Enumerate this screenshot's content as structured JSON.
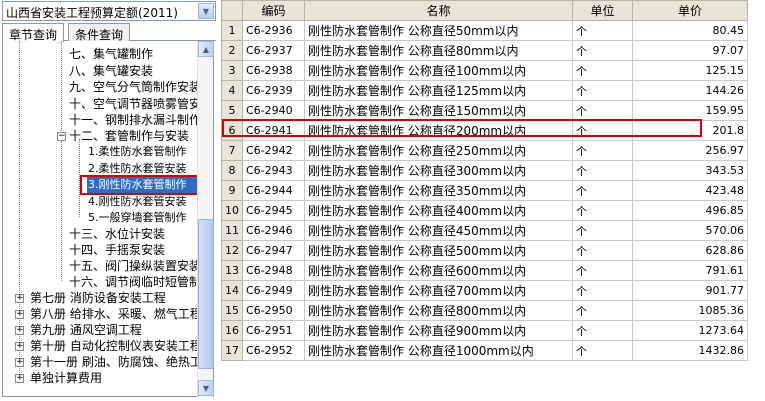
{
  "quota_select": {
    "value": "山西省安装工程预算定额(2011)"
  },
  "tabs": [
    {
      "label": "章节查询"
    },
    {
      "label": "条件查询"
    }
  ],
  "tree": [
    {
      "label": "七、集气罐制作"
    },
    {
      "label": "八、集气罐安装"
    },
    {
      "label": "九、空气分气筒制作安装"
    },
    {
      "label": "十、空气调节器喷雾管安装"
    },
    {
      "label": "十一、钢制排水漏斗制作"
    },
    {
      "label": "十二、套管制作与安装"
    },
    {
      "label": "1.柔性防水套管制作"
    },
    {
      "label": "2.柔性防水套管安装"
    },
    {
      "label": "3.刚性防水套管制作"
    },
    {
      "label": "4.刚性防水套管安装"
    },
    {
      "label": "5.一般穿墙套管制作"
    },
    {
      "label": "十三、水位计安装"
    },
    {
      "label": "十四、手摇泵安装"
    },
    {
      "label": "十五、阀门操纵装置安装"
    },
    {
      "label": "十六、调节阀临时短管制"
    },
    {
      "label": "第七册 消防设备安装工程"
    },
    {
      "label": "第八册 给排水、采暖、燃气工程"
    },
    {
      "label": "第九册 通风空调工程"
    },
    {
      "label": "第十册 自动化控制仪表安装工程"
    },
    {
      "label": "第十一册 刷油、防腐蚀、绝热工程"
    },
    {
      "label": "单独计算费用"
    }
  ],
  "grid": {
    "headers": [
      "",
      "编码",
      "名称",
      "单位",
      "单价"
    ],
    "rows": [
      {
        "n": "1",
        "code": "C6-2936",
        "name": "刚性防水套管制作 公称直径50mm以内",
        "unit": "个",
        "price": "80.45"
      },
      {
        "n": "2",
        "code": "C6-2937",
        "name": "刚性防水套管制作 公称直径80mm以内",
        "unit": "个",
        "price": "97.07"
      },
      {
        "n": "3",
        "code": "C6-2938",
        "name": "刚性防水套管制作 公称直径100mm以内",
        "unit": "个",
        "price": "125.15"
      },
      {
        "n": "4",
        "code": "C6-2939",
        "name": "刚性防水套管制作 公称直径125mm以内",
        "unit": "个",
        "price": "144.26"
      },
      {
        "n": "5",
        "code": "C6-2940",
        "name": "刚性防水套管制作 公称直径150mm以内",
        "unit": "个",
        "price": "159.95"
      },
      {
        "n": "6",
        "code": "C6-2941",
        "name": "刚性防水套管制作 公称直径200mm以内",
        "unit": "个",
        "price": "201.8"
      },
      {
        "n": "7",
        "code": "C6-2942",
        "name": "刚性防水套管制作 公称直径250mm以内",
        "unit": "个",
        "price": "256.97"
      },
      {
        "n": "8",
        "code": "C6-2943",
        "name": "刚性防水套管制作 公称直径300mm以内",
        "unit": "个",
        "price": "343.53"
      },
      {
        "n": "9",
        "code": "C6-2944",
        "name": "刚性防水套管制作 公称直径350mm以内",
        "unit": "个",
        "price": "423.48"
      },
      {
        "n": "10",
        "code": "C6-2945",
        "name": "刚性防水套管制作 公称直径400mm以内",
        "unit": "个",
        "price": "496.85"
      },
      {
        "n": "11",
        "code": "C6-2946",
        "name": "刚性防水套管制作 公称直径450mm以内",
        "unit": "个",
        "price": "570.06"
      },
      {
        "n": "12",
        "code": "C6-2947",
        "name": "刚性防水套管制作 公称直径500mm以内",
        "unit": "个",
        "price": "628.86"
      },
      {
        "n": "13",
        "code": "C6-2948",
        "name": "刚性防水套管制作 公称直径600mm以内",
        "unit": "个",
        "price": "791.61"
      },
      {
        "n": "14",
        "code": "C6-2949",
        "name": "刚性防水套管制作 公称直径700mm以内",
        "unit": "个",
        "price": "901.77"
      },
      {
        "n": "15",
        "code": "C6-2950",
        "name": "刚性防水套管制作 公称直径800mm以内",
        "unit": "个",
        "price": "1085.36"
      },
      {
        "n": "16",
        "code": "C6-2951",
        "name": "刚性防水套管制作 公称直径900mm以内",
        "unit": "个",
        "price": "1273.64"
      },
      {
        "n": "17",
        "code": "C6-2952",
        "name": "刚性防水套管制作 公称直径1000mm以内",
        "unit": "个",
        "price": "1432.86"
      }
    ]
  },
  "icons": {
    "dropdown": "chevron-down-icon",
    "expand": "plus-icon",
    "collapse": "minus-icon",
    "scroll_up": "arrow-up-icon",
    "scroll_down": "arrow-down-icon"
  },
  "colors": {
    "highlight_border": "#d20000",
    "selection": "#316ac5",
    "header_bg": "#e8e4d8"
  }
}
